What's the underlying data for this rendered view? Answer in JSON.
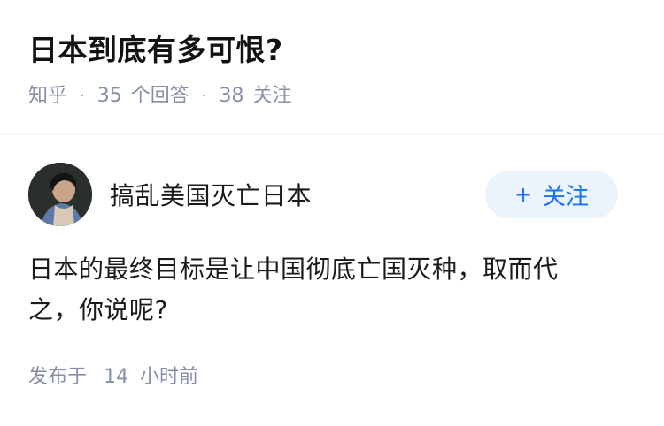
{
  "question": {
    "title": "日本到底有多可恨?",
    "source": "知乎",
    "answer_count": "35",
    "answer_label": "个回答",
    "follower_count": "38",
    "follower_label": "关注"
  },
  "answer": {
    "author_name": "搞乱美国灭亡日本",
    "follow_label": "关注",
    "follow_icon": "plus-icon",
    "content": "日本的最终目标是让中国彻底亡国灭种，取而代之，你说呢?",
    "published_prefix": "发布于",
    "published_num": "14",
    "published_suffix": "小时前"
  },
  "colors": {
    "accent": "#1772f6",
    "follow_bg": "#ebf3fd",
    "meta": "#8590a6"
  }
}
